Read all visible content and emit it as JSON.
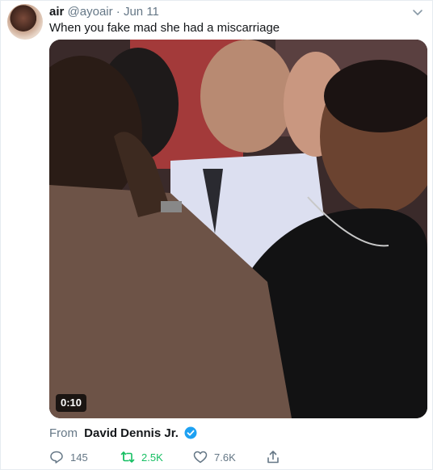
{
  "tweet": {
    "author_name": "air",
    "handle": "@ayoair",
    "separator": "·",
    "date": "Jun 11",
    "text": "When you fake mad she had a miscarriage"
  },
  "media": {
    "video_time": "0:10"
  },
  "attribution": {
    "prefix": "From",
    "author": "David Dennis Jr."
  },
  "actions": {
    "reply_count": "145",
    "retweet_count": "2.5K",
    "like_count": "7.6K"
  },
  "colors": {
    "retweet_green": "#17bf63",
    "verified_blue": "#1da1f2",
    "muted": "#657786"
  },
  "icons": [
    "chevron-down-icon",
    "verified-badge-icon",
    "reply-icon",
    "retweet-icon",
    "like-icon",
    "share-icon"
  ]
}
